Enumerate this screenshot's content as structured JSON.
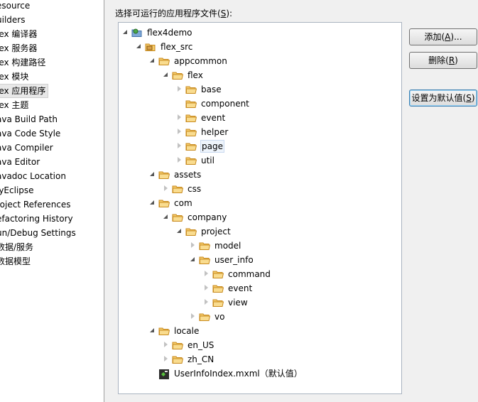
{
  "left_panel": {
    "items": [
      {
        "label": "esource"
      },
      {
        "label": "uilders"
      },
      {
        "label": "lex 编译器"
      },
      {
        "label": "lex 服务器"
      },
      {
        "label": "lex 构建路径"
      },
      {
        "label": "lex 模块"
      },
      {
        "label": "lex 应用程序",
        "selected": true
      },
      {
        "label": "lex 主题"
      },
      {
        "label": "ava Build Path"
      },
      {
        "label": "ava Code Style"
      },
      {
        "label": "ava Compiler"
      },
      {
        "label": "ava Editor"
      },
      {
        "label": "avadoc Location"
      },
      {
        "label": "lyEclipse"
      },
      {
        "label": "roject References"
      },
      {
        "label": "efactoring History"
      },
      {
        "label": "un/Debug Settings"
      },
      {
        "label": "数据/服务"
      },
      {
        "label": "数据模型"
      }
    ]
  },
  "prompt": {
    "text": "选择可运行的应用程序文件(",
    "mnemonic": "S",
    "suffix": "):"
  },
  "tree": [
    {
      "label": "flex4demo",
      "depth": 0,
      "state": "expanded",
      "icon": "project-icon"
    },
    {
      "label": "flex_src",
      "depth": 1,
      "state": "expanded",
      "icon": "source-folder-icon"
    },
    {
      "label": "appcommon",
      "depth": 2,
      "state": "expanded",
      "icon": "folder-icon"
    },
    {
      "label": "flex",
      "depth": 3,
      "state": "expanded",
      "icon": "folder-icon"
    },
    {
      "label": "base",
      "depth": 4,
      "state": "collapsed",
      "icon": "folder-icon"
    },
    {
      "label": "component",
      "depth": 4,
      "state": "none",
      "icon": "folder-icon"
    },
    {
      "label": "event",
      "depth": 4,
      "state": "collapsed",
      "icon": "folder-icon"
    },
    {
      "label": "helper",
      "depth": 4,
      "state": "collapsed",
      "icon": "folder-icon"
    },
    {
      "label": "page",
      "depth": 4,
      "state": "collapsed",
      "icon": "folder-icon",
      "hover": true
    },
    {
      "label": "util",
      "depth": 4,
      "state": "collapsed",
      "icon": "folder-icon"
    },
    {
      "label": "assets",
      "depth": 2,
      "state": "expanded",
      "icon": "folder-icon"
    },
    {
      "label": "css",
      "depth": 3,
      "state": "collapsed",
      "icon": "folder-icon"
    },
    {
      "label": "com",
      "depth": 2,
      "state": "expanded",
      "icon": "folder-icon"
    },
    {
      "label": "company",
      "depth": 3,
      "state": "expanded",
      "icon": "folder-icon"
    },
    {
      "label": "project",
      "depth": 4,
      "state": "expanded",
      "icon": "folder-icon"
    },
    {
      "label": "model",
      "depth": 5,
      "state": "collapsed",
      "icon": "folder-icon"
    },
    {
      "label": "user_info",
      "depth": 5,
      "state": "expanded",
      "icon": "folder-icon"
    },
    {
      "label": "command",
      "depth": 6,
      "state": "collapsed",
      "icon": "folder-icon"
    },
    {
      "label": "event",
      "depth": 6,
      "state": "collapsed",
      "icon": "folder-icon"
    },
    {
      "label": "view",
      "depth": 6,
      "state": "collapsed",
      "icon": "folder-icon"
    },
    {
      "label": "vo",
      "depth": 5,
      "state": "collapsed",
      "icon": "folder-icon"
    },
    {
      "label": "locale",
      "depth": 2,
      "state": "expanded",
      "icon": "folder-icon"
    },
    {
      "label": "en_US",
      "depth": 3,
      "state": "collapsed",
      "icon": "folder-icon"
    },
    {
      "label": "zh_CN",
      "depth": 3,
      "state": "collapsed",
      "icon": "folder-icon"
    },
    {
      "label": "UserInfoIndex.mxml（默认值）",
      "depth": 2,
      "state": "none",
      "icon": "mxml-file-icon",
      "highlighted": true
    }
  ],
  "buttons": {
    "add": {
      "pre": "添加(",
      "mn": "A",
      "post": ")..."
    },
    "remove": {
      "pre": "删除(",
      "mn": "R",
      "post": ")"
    },
    "set_default": {
      "pre": "设置为默认值(",
      "mn": "S",
      "post": ")"
    }
  },
  "colors": {
    "highlight": "#ffff2e",
    "folder": "#f2c15b",
    "folder_dark": "#c88a1d"
  }
}
